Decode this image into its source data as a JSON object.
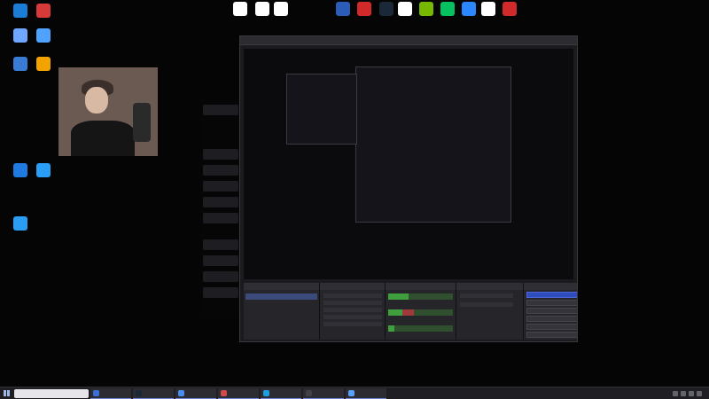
{
  "desktop": {
    "left_icons": [
      {
        "name": "icon-left-1",
        "color": "#1b7dd6"
      },
      {
        "name": "icon-left-2",
        "color": "#d83a3a"
      },
      {
        "name": "icon-left-3",
        "color": "#6fa6ff"
      },
      {
        "name": "icon-left-4",
        "color": "#4fa3ff"
      },
      {
        "name": "icon-left-5",
        "color": "#3a7bd5"
      },
      {
        "name": "icon-left-6",
        "color": "#f2a300"
      },
      {
        "name": "icon-left-7",
        "color": "#1f7be0"
      },
      {
        "name": "icon-left-8",
        "color": "#2a9df4"
      },
      {
        "name": "icon-left-9",
        "color": "#2a9df4"
      }
    ],
    "top_icons": [
      {
        "name": "icon-top-1",
        "color": "#ffffff"
      },
      {
        "name": "icon-top-2",
        "color": "#ffffff"
      },
      {
        "name": "icon-top-3",
        "color": "#ffffff"
      },
      {
        "name": "icon-top-4",
        "color": "#2b5db8"
      },
      {
        "name": "icon-top-5",
        "color": "#d22a2a"
      },
      {
        "name": "icon-top-6",
        "color": "#1b2838"
      },
      {
        "name": "icon-top-7",
        "color": "#ffffff"
      },
      {
        "name": "icon-top-8",
        "color": "#76b900"
      },
      {
        "name": "icon-top-9",
        "color": "#07c160"
      },
      {
        "name": "icon-top-10",
        "color": "#2b87ff"
      },
      {
        "name": "icon-top-11",
        "color": "#ffffff"
      },
      {
        "name": "icon-top-12",
        "color": "#d02a2a"
      }
    ]
  },
  "taskbar": {
    "items": [
      {
        "name": "taskbar-item-1",
        "color": "#3b6fd8"
      },
      {
        "name": "taskbar-item-2",
        "color": "#1b2838"
      },
      {
        "name": "taskbar-item-3",
        "color": "#4a8ef0"
      },
      {
        "name": "taskbar-item-4",
        "color": "#d04a4a"
      },
      {
        "name": "taskbar-item-5",
        "color": "#1e9fe0"
      },
      {
        "name": "taskbar-item-6",
        "color": "#404046"
      },
      {
        "name": "taskbar-item-7",
        "color": "#5aa0ff"
      }
    ]
  },
  "obs": {
    "mixer": [
      {
        "level": 0.32,
        "warn": 0.0
      },
      {
        "level": 0.22,
        "warn": 0.18
      },
      {
        "level": 0.1,
        "warn": 0.0
      }
    ]
  }
}
